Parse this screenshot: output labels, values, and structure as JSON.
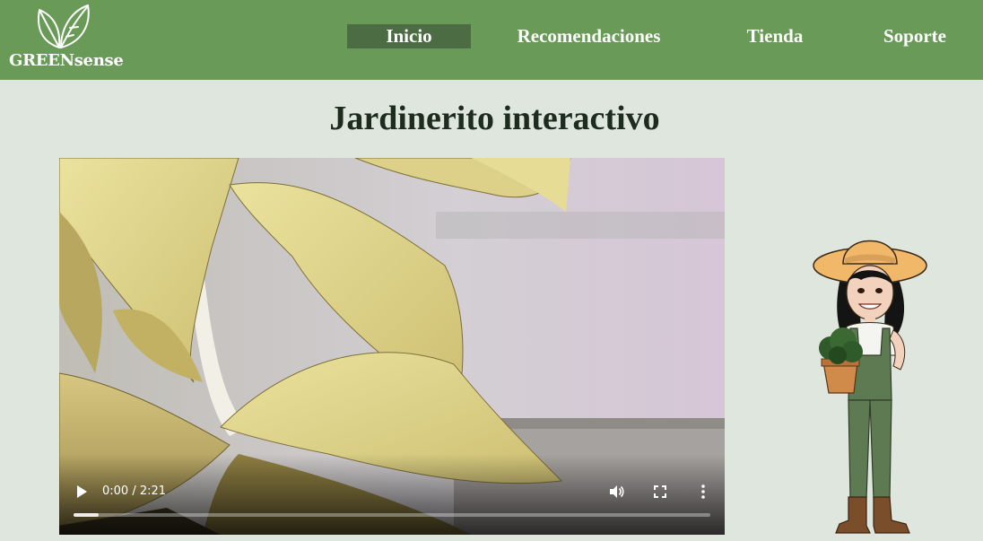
{
  "brand": {
    "name": "GREENsense",
    "logo_icon": "leaves-icon"
  },
  "nav": {
    "items": [
      {
        "label": "Inicio",
        "active": true
      },
      {
        "label": "Recomendaciones",
        "active": false
      },
      {
        "label": "Tienda",
        "active": false
      },
      {
        "label": "Soporte",
        "active": false
      }
    ]
  },
  "main": {
    "title": "Jardinerito interactivo"
  },
  "video": {
    "time_display": "0:00 / 2:21",
    "current_time": "0:00",
    "duration": "2:21",
    "progress_buffered_fraction": 0.04,
    "icons": {
      "play": "play-icon",
      "volume": "volume-icon",
      "fullscreen": "fullscreen-icon",
      "more": "more-options-icon"
    }
  },
  "colors": {
    "header_bg": "#699a58",
    "active_nav_bg": "#4c6d43",
    "page_bg": "#dfe6de",
    "title_text": "#1e2b1f"
  }
}
